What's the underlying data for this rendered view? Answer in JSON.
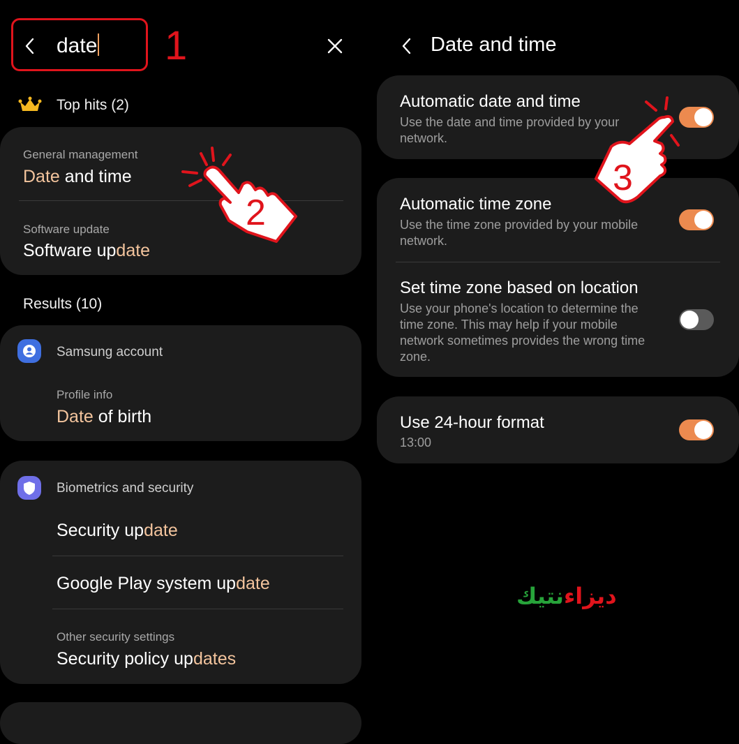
{
  "steps": {
    "one": "1",
    "two": "2",
    "three": "3"
  },
  "search": {
    "query": "date",
    "back_icon": "chevron-left-icon",
    "clear_icon": "close-icon"
  },
  "top_hits": {
    "label": "Top hits (2)",
    "icon": "crown-icon",
    "items": [
      {
        "category": "General management",
        "hl": "Date",
        "rest": " and time"
      },
      {
        "category": "Software update",
        "pre": "Software up",
        "hl": "date"
      }
    ]
  },
  "results": {
    "label": "Results (10)",
    "groups": [
      {
        "app": "Samsung account",
        "icon": "account-icon",
        "items": [
          {
            "category": "Profile info",
            "hl": "Date",
            "rest": " of birth"
          }
        ]
      },
      {
        "app": "Biometrics and security",
        "icon": "shield-icon",
        "items": [
          {
            "pre": "Security up",
            "hl": "date"
          },
          {
            "pre": "Google Play system up",
            "hl": "date"
          },
          {
            "category": "Other security settings",
            "pre": "Security policy up",
            "hl": "dates"
          }
        ]
      }
    ]
  },
  "date_time": {
    "title": "Date and time",
    "settings": [
      {
        "title": "Automatic date and time",
        "desc": "Use the date and time provided by your network.",
        "on": true
      },
      {
        "title": "Automatic time zone",
        "desc": "Use the time zone provided by your mobile network.",
        "on": true
      },
      {
        "title": "Set time zone based on location",
        "desc": "Use your phone's location to determine the time zone. This may help if your mobile network sometimes provides the wrong time zone.",
        "on": false
      },
      {
        "title": "Use 24-hour format",
        "desc": "13:00",
        "on": true
      }
    ]
  },
  "watermark": {
    "part1": "ديزاء",
    "part2": "نتيك"
  },
  "colors": {
    "accent": "#ec8a4f",
    "highlight": "#f3c49d",
    "annotation": "#e0141c",
    "card": "#1c1c1c"
  }
}
